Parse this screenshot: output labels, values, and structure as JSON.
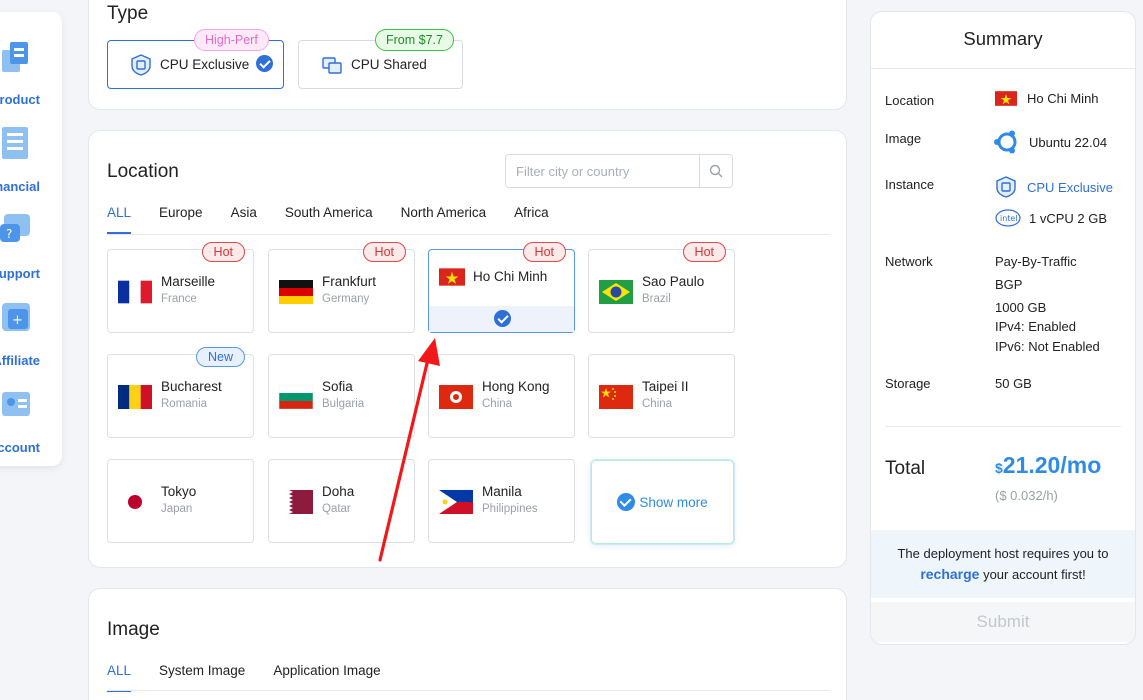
{
  "nav": {
    "items": [
      {
        "label": "Product"
      },
      {
        "label": "Financial"
      },
      {
        "label": "Support"
      },
      {
        "label": "Affiliate"
      },
      {
        "label": "Account"
      }
    ]
  },
  "type": {
    "title": "Type",
    "options": [
      {
        "label": "CPU Exclusive",
        "badge": "High-Perf",
        "selected": true
      },
      {
        "label": "CPU Shared",
        "badge": "From $7.7",
        "selected": false
      }
    ]
  },
  "location": {
    "title": "Location",
    "filter_placeholder": "Filter city or country",
    "tabs": [
      "ALL",
      "Europe",
      "Asia",
      "South America",
      "North America",
      "Africa"
    ],
    "active_tab": "ALL",
    "items": [
      {
        "city": "Marseille",
        "country": "France",
        "tag": "Hot",
        "flag": "france"
      },
      {
        "city": "Frankfurt",
        "country": "Germany",
        "tag": "Hot",
        "flag": "germany"
      },
      {
        "city": "Ho Chi Minh",
        "country": "",
        "tag": "Hot",
        "flag": "vietnam",
        "selected": true
      },
      {
        "city": "Sao Paulo",
        "country": "Brazil",
        "tag": "Hot",
        "flag": "brazil"
      },
      {
        "city": "Bucharest",
        "country": "Romania",
        "tag": "New",
        "flag": "romania"
      },
      {
        "city": "Sofia",
        "country": "Bulgaria",
        "tag": "",
        "flag": "bulgaria"
      },
      {
        "city": "Hong Kong",
        "country": "China",
        "tag": "",
        "flag": "hongkong"
      },
      {
        "city": "Taipei II",
        "country": "China",
        "tag": "",
        "flag": "china"
      },
      {
        "city": "Tokyo",
        "country": "Japan",
        "tag": "",
        "flag": "japan"
      },
      {
        "city": "Doha",
        "country": "Qatar",
        "tag": "",
        "flag": "qatar"
      },
      {
        "city": "Manila",
        "country": "Philippines",
        "tag": "",
        "flag": "philippines"
      }
    ],
    "show_more": "Show more"
  },
  "image": {
    "title": "Image",
    "tabs": [
      "ALL",
      "System Image",
      "Application Image"
    ],
    "active_tab": "ALL"
  },
  "summary": {
    "title": "Summary",
    "location_label": "Location",
    "location_value": "Ho Chi Minh",
    "image_label": "Image",
    "image_value": "Ubuntu 22.04",
    "instance_label": "Instance",
    "instance_type": "CPU Exclusive",
    "instance_spec": "1 vCPU 2 GB",
    "network_label": "Network",
    "network_values": [
      "Pay-By-Traffic",
      "BGP",
      "1000 GB",
      "IPv4: Enabled",
      "IPv6: Not Enabled"
    ],
    "storage_label": "Storage",
    "storage_value": "50 GB",
    "total_label": "Total",
    "price_currency": "$",
    "price_amount": "21.20/mo",
    "price_hourly": "($ 0.032/h)",
    "notice_pre": "The deployment host requires you to",
    "notice_link": "recharge",
    "notice_post": " your account first!",
    "submit_label": "Submit"
  },
  "colors": {
    "accent": "#2f6fd8",
    "hot": "#d63434",
    "arrow": "#f01818"
  }
}
